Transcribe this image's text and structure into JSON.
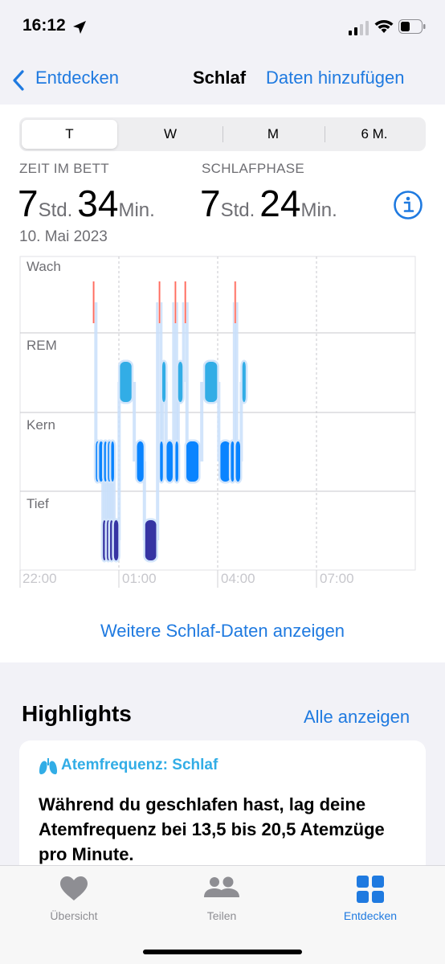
{
  "status_bar": {
    "time": "16:12"
  },
  "nav": {
    "back_label": "Entdecken",
    "title": "Schlaf",
    "action_label": "Daten hinzufügen"
  },
  "segments": [
    "T",
    "W",
    "M",
    "6 M."
  ],
  "selected_segment": "T",
  "stats": {
    "in_bed": {
      "label": "ZEIT IM BETT",
      "hours": "7",
      "hours_unit": "Std.",
      "minutes": "34",
      "minutes_unit": "Min."
    },
    "asleep": {
      "label": "SCHLAFPHASE",
      "hours": "7",
      "hours_unit": "Std.",
      "minutes": "24",
      "minutes_unit": "Min."
    },
    "date": "10. Mai 2023"
  },
  "chart_data": {
    "type": "timeline",
    "stages": [
      "Wach",
      "REM",
      "Kern",
      "Tief"
    ],
    "x_ticks": [
      "22:00",
      "01:00",
      "04:00",
      "07:00"
    ],
    "stage_colors": {
      "Wach": "#ff6b5e",
      "REM": "#32ade6",
      "Kern": "#0a84ff",
      "Tief": "#3634a3"
    },
    "segments": [
      {
        "stage": "Wach",
        "start": "00:13",
        "end": "00:14"
      },
      {
        "stage": "Kern",
        "start": "00:18",
        "end": "00:24"
      },
      {
        "stage": "Kern",
        "start": "00:24",
        "end": "00:31"
      },
      {
        "stage": "Tief",
        "start": "00:31",
        "end": "00:33"
      },
      {
        "stage": "Kern",
        "start": "00:33",
        "end": "00:38"
      },
      {
        "stage": "Tief",
        "start": "00:38",
        "end": "00:40"
      },
      {
        "stage": "Kern",
        "start": "00:40",
        "end": "00:44"
      },
      {
        "stage": "Tief",
        "start": "00:44",
        "end": "00:46"
      },
      {
        "stage": "Kern",
        "start": "00:46",
        "end": "00:51"
      },
      {
        "stage": "Tief",
        "start": "00:51",
        "end": "00:59"
      },
      {
        "stage": "REM",
        "start": "01:02",
        "end": "01:23"
      },
      {
        "stage": "Kern",
        "start": "01:33",
        "end": "01:45"
      },
      {
        "stage": "Tief",
        "start": "01:48",
        "end": "02:08"
      },
      {
        "stage": "Wach",
        "start": "02:13",
        "end": "02:14"
      },
      {
        "stage": "Kern",
        "start": "02:15",
        "end": "02:18"
      },
      {
        "stage": "REM",
        "start": "02:19",
        "end": "02:25"
      },
      {
        "stage": "Kern",
        "start": "02:27",
        "end": "02:38"
      },
      {
        "stage": "Wach",
        "start": "02:42",
        "end": "02:43"
      },
      {
        "stage": "Kern",
        "start": "02:43",
        "end": "02:47"
      },
      {
        "stage": "REM",
        "start": "02:48",
        "end": "02:56"
      },
      {
        "stage": "Wach",
        "start": "03:00",
        "end": "03:01"
      },
      {
        "stage": "Kern",
        "start": "03:03",
        "end": "03:25"
      },
      {
        "stage": "REM",
        "start": "03:37",
        "end": "03:59"
      },
      {
        "stage": "Kern",
        "start": "04:05",
        "end": "04:23"
      },
      {
        "stage": "Kern",
        "start": "04:24",
        "end": "04:30"
      },
      {
        "stage": "Wach",
        "start": "04:31",
        "end": "04:32"
      },
      {
        "stage": "Kern",
        "start": "04:33",
        "end": "04:41"
      },
      {
        "stage": "REM",
        "start": "04:45",
        "end": "04:51"
      }
    ]
  },
  "more_link": "Weitere Schlaf-Daten anzeigen",
  "highlights": {
    "title": "Highlights",
    "show_all": "Alle anzeigen",
    "card": {
      "category": "Atemfrequenz: Schlaf",
      "text": "Während du geschlafen hast, lag deine Atemfrequenz bei 13,5 bis 20,5 Atemzüge pro Minute."
    }
  },
  "tabbar": [
    {
      "label": "Übersicht",
      "icon": "heart-icon",
      "active": false
    },
    {
      "label": "Teilen",
      "icon": "people-icon",
      "active": false
    },
    {
      "label": "Entdecken",
      "icon": "grid-icon",
      "active": true
    }
  ],
  "colors": {
    "accent": "#1f7ae0",
    "highlight_category": "#32ade6"
  }
}
